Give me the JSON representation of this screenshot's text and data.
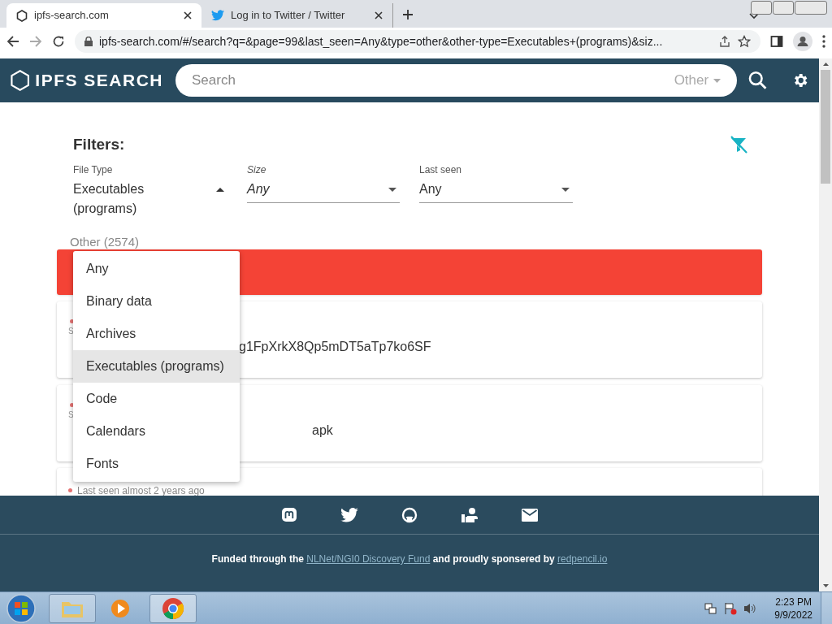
{
  "browser": {
    "tabs": [
      {
        "title": "ipfs-search.com",
        "selected": true,
        "kind": "ipfs"
      },
      {
        "title": "Log in to Twitter / Twitter",
        "selected": false,
        "kind": "twitter"
      }
    ],
    "url": "ipfs-search.com/#/search?q=&page=99&last_seen=Any&type=other&other-type=Executables+(programs)&siz..."
  },
  "header": {
    "logo": "IPFS SEARCH",
    "search_placeholder": "Search",
    "type_select": "Other"
  },
  "filters": {
    "title": "Filters:",
    "fields": [
      {
        "label": "File Type",
        "value": "Executables (programs)",
        "expanded": true,
        "emphasized": false
      },
      {
        "label": "Size",
        "value": "Any",
        "expanded": false,
        "emphasized": true
      },
      {
        "label": "Last seen",
        "value": "Any",
        "expanded": false,
        "emphasized": false
      }
    ]
  },
  "result_count": "Other (2574)",
  "cards": [
    {
      "letter": "S",
      "title_end": "g1FpXrkX8Qp5mDT5aTp7ko6SF"
    },
    {
      "letter": "S",
      "title_end": "apk"
    }
  ],
  "last_card": {
    "last_seen": "Last seen almost 2 years ago"
  },
  "dropdown": [
    {
      "label": "Any",
      "selected": false
    },
    {
      "label": "Binary data",
      "selected": false
    },
    {
      "label": "Archives",
      "selected": false
    },
    {
      "label": "Executables (programs)",
      "selected": true
    },
    {
      "label": "Code",
      "selected": false
    },
    {
      "label": "Calendars",
      "selected": false
    },
    {
      "label": "Fonts",
      "selected": false
    }
  ],
  "footer": {
    "parts": [
      {
        "kind": "text",
        "text": "Funded through the "
      },
      {
        "kind": "link",
        "text": "NLNet/NGI0 Discovery Fund"
      },
      {
        "kind": "text",
        "text": " and proudly sponsered by "
      },
      {
        "kind": "link",
        "text": "redpencil.io"
      }
    ]
  },
  "taskbar": {
    "time": "2:23 PM",
    "date": "9/9/2022"
  }
}
